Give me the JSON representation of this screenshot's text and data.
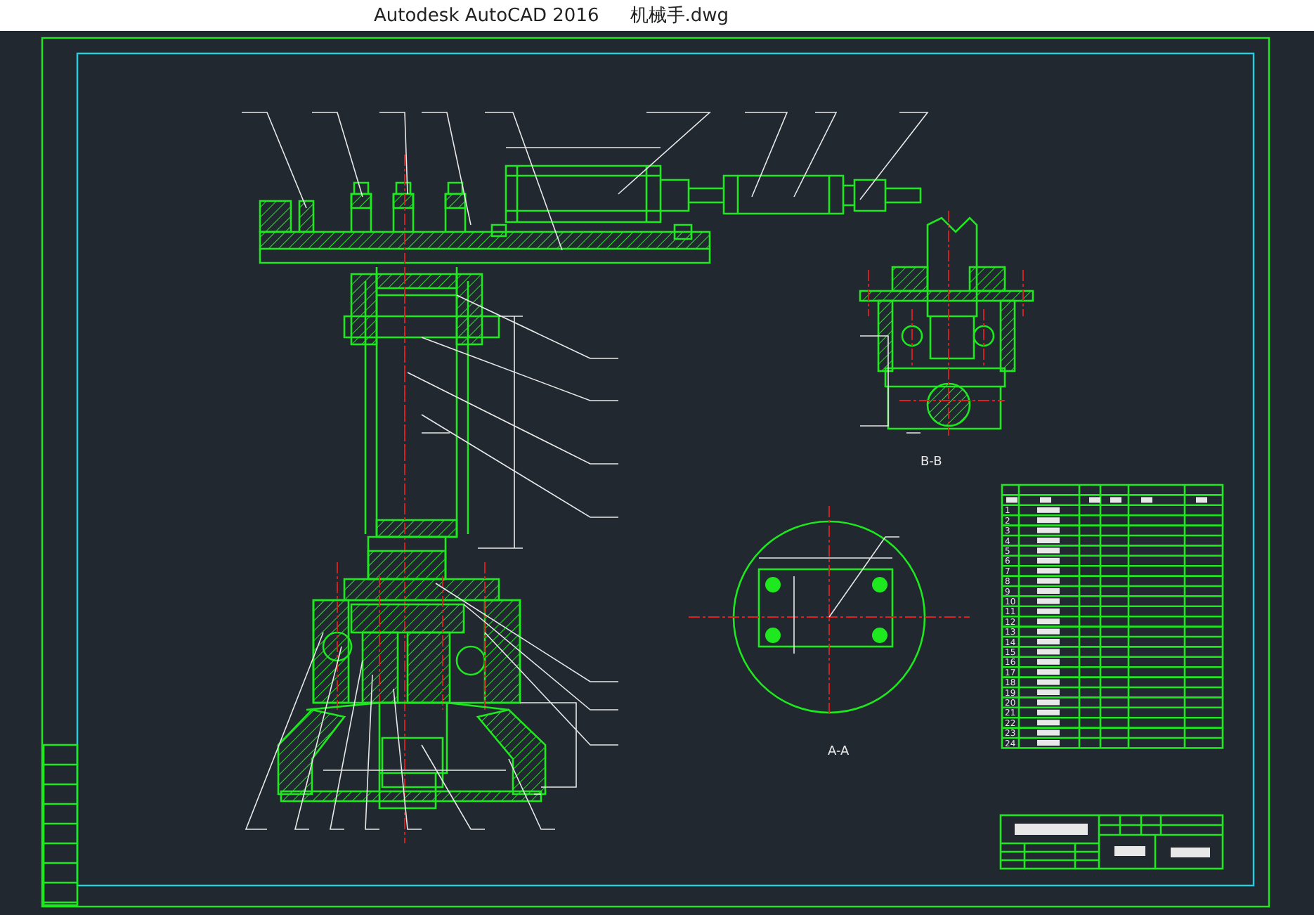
{
  "window": {
    "app": "Autodesk AutoCAD 2016",
    "file": "机械手.dwg"
  },
  "views": [
    {
      "kind": "section-b",
      "label": "B-B"
    },
    {
      "kind": "section-a",
      "label": "A-A"
    }
  ],
  "parts_list": {
    "rows": [
      {
        "no": "1"
      },
      {
        "no": "2"
      },
      {
        "no": "3"
      },
      {
        "no": "4"
      },
      {
        "no": "5"
      },
      {
        "no": "6"
      },
      {
        "no": "7"
      },
      {
        "no": "8"
      },
      {
        "no": "9"
      },
      {
        "no": "10"
      },
      {
        "no": "11"
      },
      {
        "no": "12"
      },
      {
        "no": "13"
      },
      {
        "no": "14"
      },
      {
        "no": "15"
      },
      {
        "no": "16"
      },
      {
        "no": "17"
      },
      {
        "no": "18"
      },
      {
        "no": "19"
      },
      {
        "no": "20"
      },
      {
        "no": "21"
      },
      {
        "no": "22"
      },
      {
        "no": "23"
      },
      {
        "no": "24"
      }
    ]
  }
}
